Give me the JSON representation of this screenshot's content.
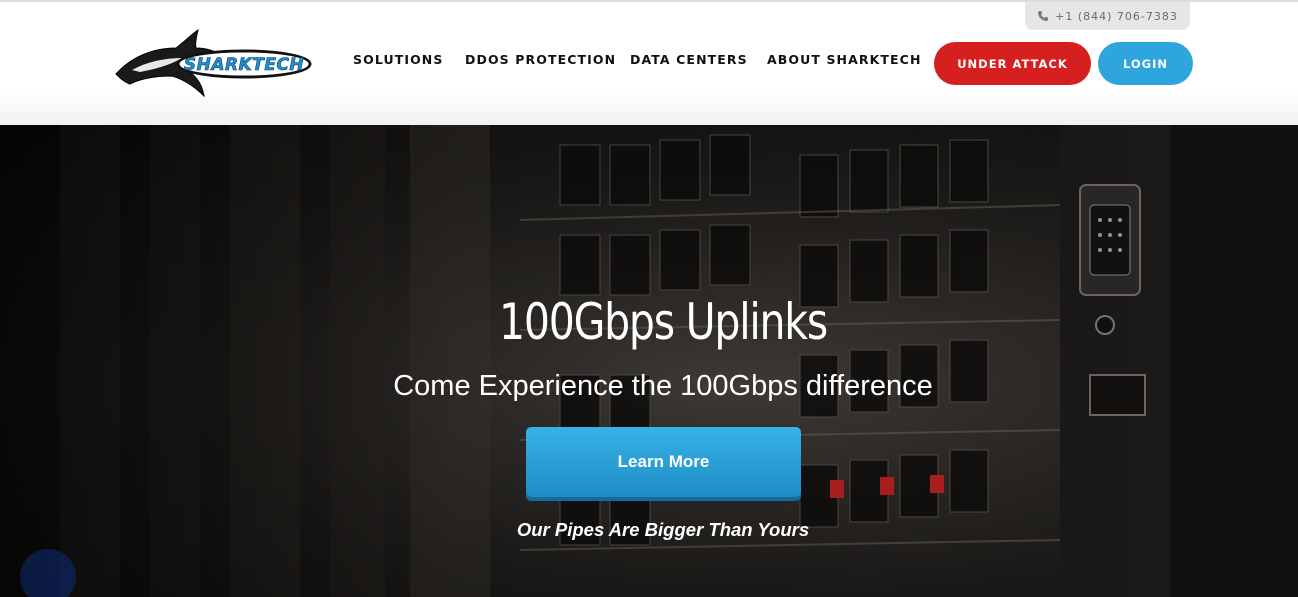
{
  "header": {
    "phone": "+1 (844) 706-7383",
    "logo_text": "SHARKTECH",
    "nav": [
      {
        "label": "SOLUTIONS"
      },
      {
        "label": "DDOS PROTECTION"
      },
      {
        "label": "DATA CENTERS"
      },
      {
        "label": "ABOUT SHARKTECH"
      }
    ],
    "under_attack_label": "UNDER ATTACK",
    "login_label": "LOGIN"
  },
  "hero": {
    "title": "100Gbps Uplinks",
    "subtitle": "Come Experience the 100Gbps difference",
    "cta_label": "Learn More",
    "tagline": "Our Pipes Are Bigger Than Yours"
  },
  "colors": {
    "under_attack": "#d6201f",
    "login": "#2ea6dd",
    "cta": "#2aa3db",
    "phone_pill": "#e6e6e6"
  },
  "icons": {
    "phone": "phone-icon",
    "logo": "shark-logo-icon"
  }
}
